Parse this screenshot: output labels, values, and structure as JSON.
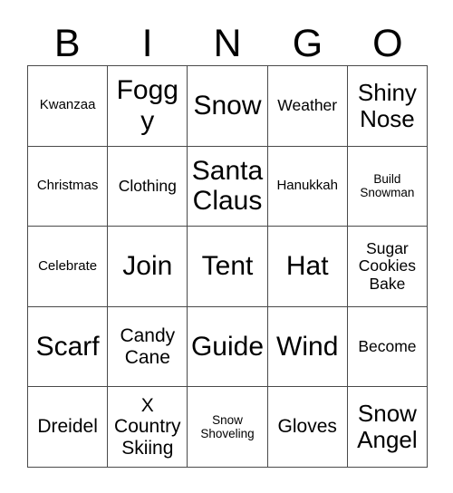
{
  "card": {
    "title": "BINGO",
    "header_letters": [
      "B",
      "I",
      "N",
      "G",
      "O"
    ],
    "colors": {
      "background": "#ffffff",
      "text": "#000000",
      "grid_line": "#4a4a4a"
    },
    "grid": {
      "columns": 5,
      "rows": 5
    },
    "cells": [
      [
        {
          "text": "Kwanzaa",
          "size": "sm"
        },
        {
          "text": "Foggy",
          "size": "xxl"
        },
        {
          "text": "Snow",
          "size": "xxl"
        },
        {
          "text": "Weather",
          "size": "md"
        },
        {
          "text": "Shiny\nNose",
          "size": "xl"
        }
      ],
      [
        {
          "text": "Christmas",
          "size": "sm"
        },
        {
          "text": "Clothing",
          "size": "md"
        },
        {
          "text": "Santa\nClaus",
          "size": "xxl"
        },
        {
          "text": "Hanukkah",
          "size": "sm"
        },
        {
          "text": "Build\nSnowman",
          "size": "xs"
        }
      ],
      [
        {
          "text": "Celebrate",
          "size": "sm"
        },
        {
          "text": "Join",
          "size": "xxl"
        },
        {
          "text": "Tent",
          "size": "xxl"
        },
        {
          "text": "Hat",
          "size": "xxl"
        },
        {
          "text": "Sugar\nCookies\nBake",
          "size": "md"
        }
      ],
      [
        {
          "text": "Scarf",
          "size": "xxl"
        },
        {
          "text": "Candy\nCane",
          "size": "lg"
        },
        {
          "text": "Guide",
          "size": "xxl"
        },
        {
          "text": "Wind",
          "size": "xxl"
        },
        {
          "text": "Become",
          "size": "md"
        }
      ],
      [
        {
          "text": "Dreidel",
          "size": "lg"
        },
        {
          "text": "X\nCountry\nSkiing",
          "size": "lg"
        },
        {
          "text": "Snow\nShoveling",
          "size": "xs"
        },
        {
          "text": "Gloves",
          "size": "lg"
        },
        {
          "text": "Snow\nAngel",
          "size": "xl"
        }
      ]
    ]
  }
}
